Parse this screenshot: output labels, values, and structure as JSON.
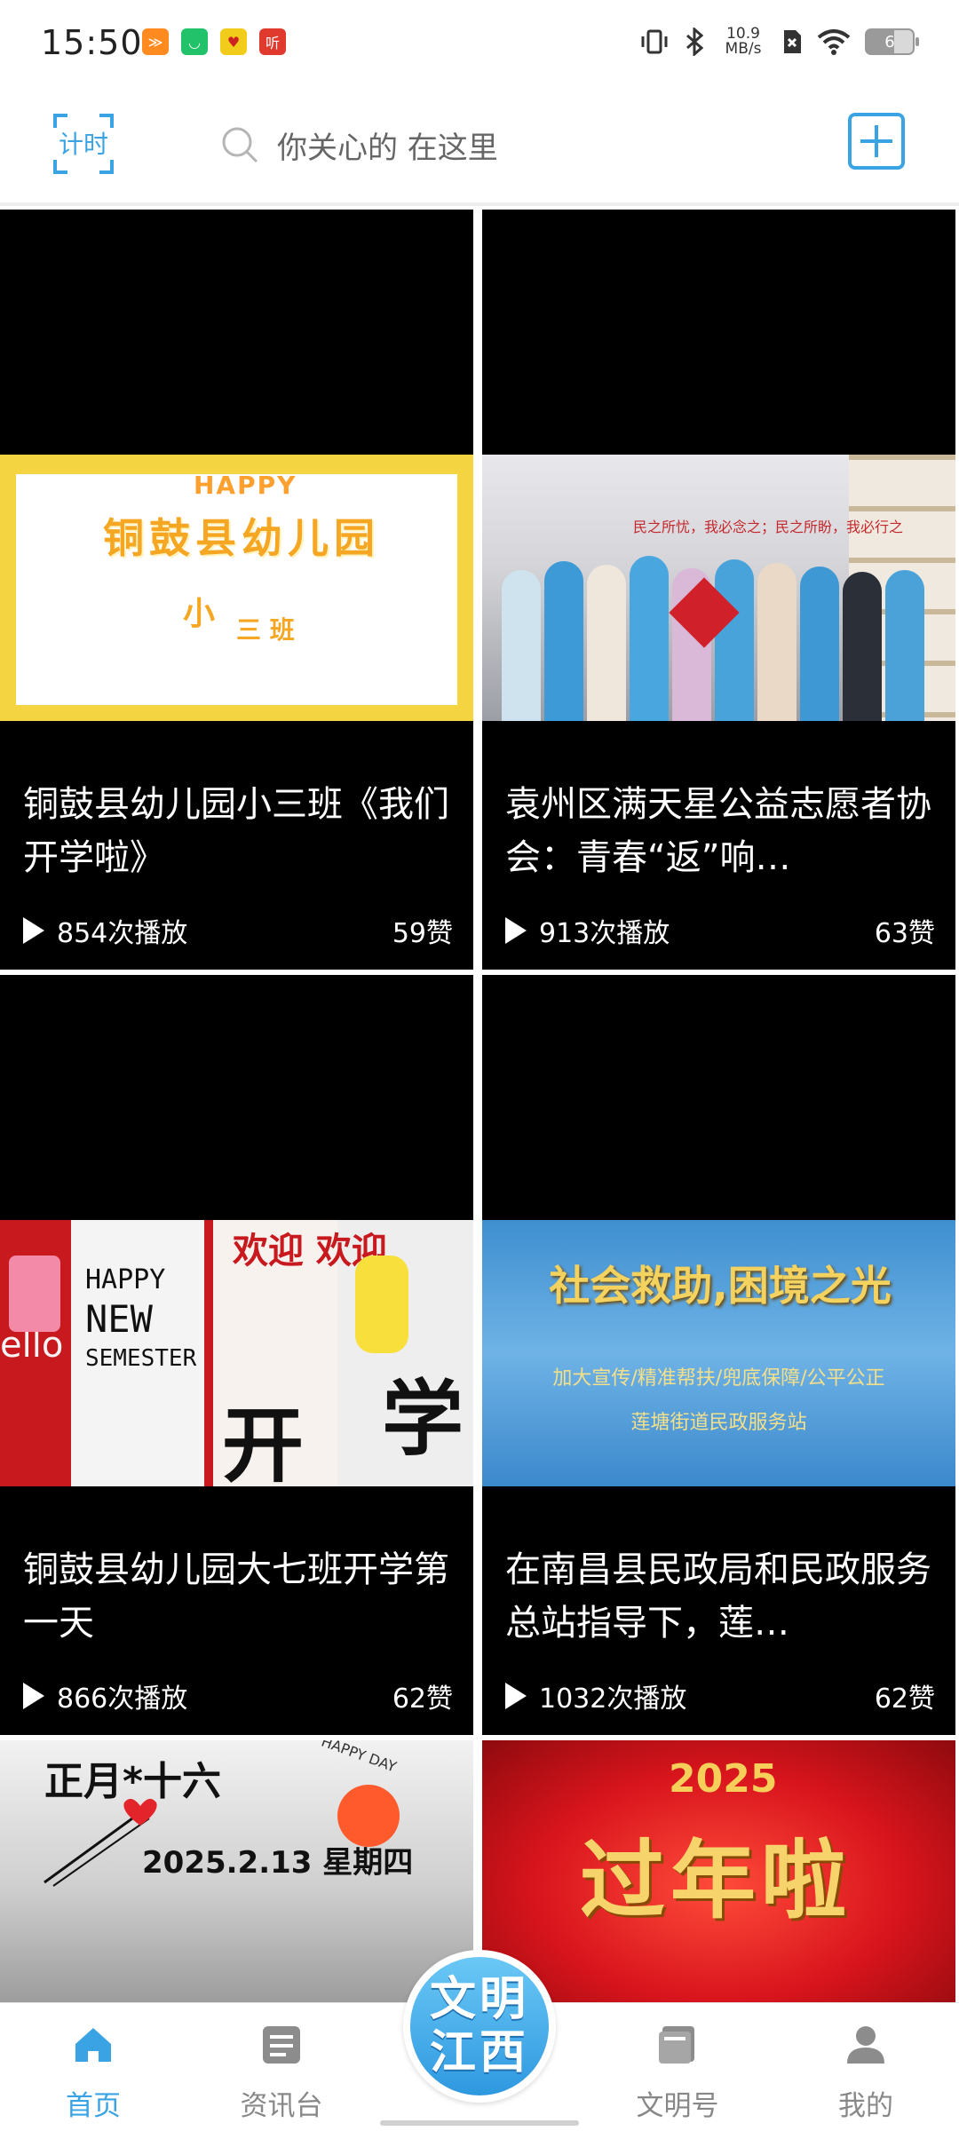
{
  "status_bar": {
    "time": "15:50",
    "net_speed_value": "10.9",
    "net_speed_unit": "MB/s",
    "battery": "6",
    "app_icons": [
      {
        "name": "app-orange-icon",
        "color": "#ff8a1f",
        "glyph": "≫"
      },
      {
        "name": "app-green-icon",
        "color": "#21c26a",
        "glyph": "◡"
      },
      {
        "name": "app-yellow-icon",
        "color": "#f2cc1b",
        "glyph": "♥"
      },
      {
        "name": "app-ting-icon",
        "color": "#e03a2f",
        "glyph": "听"
      }
    ]
  },
  "header": {
    "scan_label": "计时",
    "search_placeholder": "你关心的 在这里",
    "add_icon": "plus-square-icon"
  },
  "feed": [
    {
      "title": "铜鼓县幼儿园小三班《我们开学啦》",
      "plays": "854次播放",
      "likes": "59赞",
      "thumb": {
        "happy": "HAPPY",
        "line1": "铜鼓县幼儿园",
        "line2": "小",
        "line3": "三 班"
      }
    },
    {
      "title": "袁州区满天星公益志愿者协会：青春“返”响…",
      "plays": "913次播放",
      "likes": "63赞",
      "thumb": {
        "banner": "民之所忧，我必念之；民之所盼，我必行之"
      }
    },
    {
      "title": "铜鼓县幼儿园大七班开学第一天",
      "plays": "866次播放",
      "likes": "62赞",
      "thumb": {
        "eng1": "HAPPY",
        "eng2": "NEW",
        "eng3": "SEMESTER",
        "huanying": "欢迎 欢迎",
        "kai": "开",
        "xue": "学",
        "ello": "ello"
      }
    },
    {
      "title": "在南昌县民政局和民政服务总站指导下，莲…",
      "plays": "1032次播放",
      "likes": "62赞",
      "thumb": {
        "big": "社会救助,困境之光",
        "sub1": "加大宣传/精准帮扶/兜底保障/公平公正",
        "sub2": "莲塘街道民政服务站"
      }
    },
    {
      "title": "",
      "plays": "",
      "likes": "",
      "thumb": {
        "l1": "正月*十六",
        "l2": "2025.2.13  星期四",
        "hd": "HAPPY DAY"
      }
    },
    {
      "title": "",
      "plays": "",
      "likes": "",
      "thumb": {
        "yr": "2025",
        "main": "过年啦"
      }
    }
  ],
  "bottom_nav": {
    "items": [
      {
        "label": "首页",
        "icon": "home-icon",
        "active": true
      },
      {
        "label": "资讯台",
        "icon": "news-icon",
        "active": false
      },
      {
        "label": "文明号",
        "icon": "book-icon",
        "active": false
      },
      {
        "label": "我的",
        "icon": "user-icon",
        "active": false
      }
    ],
    "center_line1": "文明",
    "center_line2": "江西"
  },
  "colors": {
    "accent": "#3aa3e3",
    "inactive": "#888888",
    "card_bg": "#000000"
  }
}
